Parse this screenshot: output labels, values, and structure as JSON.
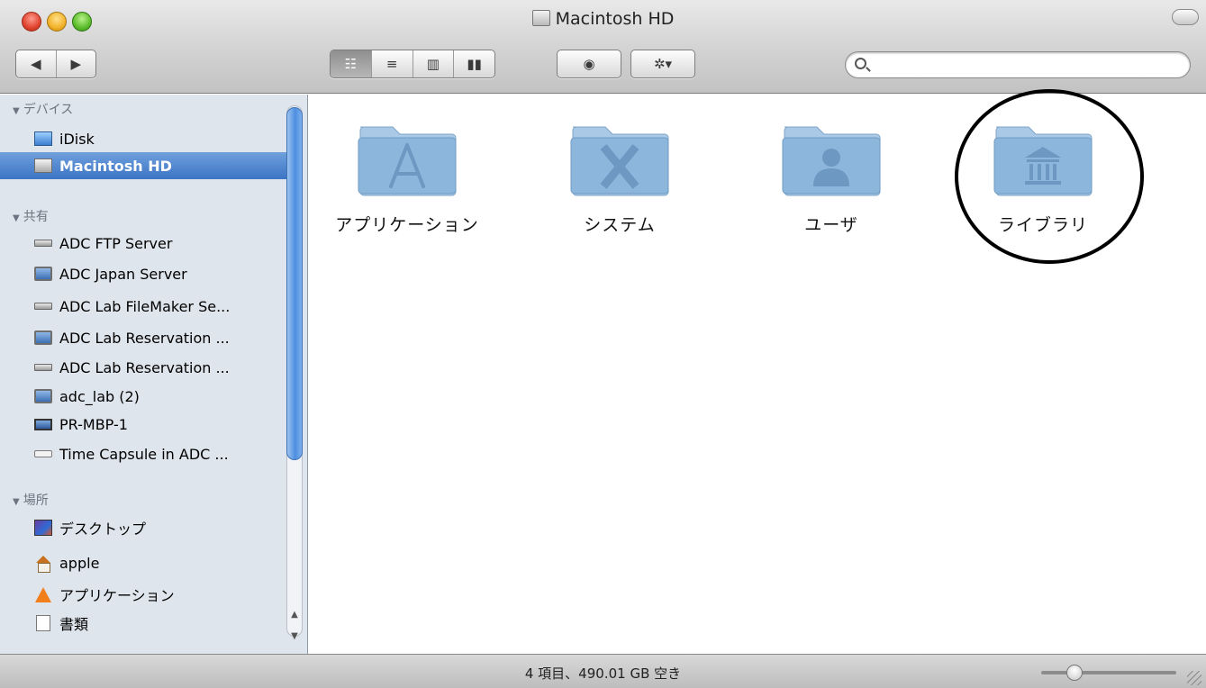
{
  "window": {
    "title": "Macintosh HD"
  },
  "toolbar": {
    "back_icon": "◀",
    "forward_icon": "▶",
    "view_icon_label": "☷",
    "view_list_label": "≡",
    "view_column_label": "▥",
    "view_coverflow_label": "▮▮",
    "quicklook_label": "◉",
    "action_label": "✲▾",
    "search_placeholder": "",
    "search_value": ""
  },
  "sidebar": {
    "devices_header": "デバイス",
    "devices": [
      {
        "label": "iDisk",
        "icon": "idisk-icon"
      },
      {
        "label": "Macintosh HD",
        "icon": "hard-disk-icon",
        "selected": true
      }
    ],
    "shared_header": "共有",
    "shared": [
      {
        "label": "ADC FTP Server",
        "icon": "server-icon"
      },
      {
        "label": "ADC Japan Server",
        "icon": "monitor-icon"
      },
      {
        "label": "ADC Lab FileMaker Se...",
        "icon": "server-icon"
      },
      {
        "label": "ADC Lab Reservation ...",
        "icon": "monitor-icon"
      },
      {
        "label": "ADC Lab Reservation ...",
        "icon": "server-icon"
      },
      {
        "label": "adc_lab (2)",
        "icon": "monitor-icon"
      },
      {
        "label": "PR-MBP-1",
        "icon": "laptop-icon"
      },
      {
        "label": "Time Capsule in ADC ...",
        "icon": "time-capsule-icon"
      }
    ],
    "places_header": "場所",
    "places": [
      {
        "label": "デスクトップ",
        "icon": "desktop-icon"
      },
      {
        "label": "apple",
        "icon": "home-icon"
      },
      {
        "label": "アプリケーション",
        "icon": "applications-icon"
      },
      {
        "label": "書類",
        "icon": "documents-icon"
      }
    ]
  },
  "content": {
    "items": [
      {
        "label": "アプリケーション",
        "glyph": "A",
        "icon": "applications-folder-icon"
      },
      {
        "label": "システム",
        "glyph": "X",
        "icon": "system-folder-icon"
      },
      {
        "label": "ユーザ",
        "glyph": "user",
        "icon": "users-folder-icon"
      },
      {
        "label": "ライブラリ",
        "glyph": "library",
        "icon": "library-folder-icon"
      }
    ]
  },
  "status": {
    "text": "4 項目、490.01 GB 空き"
  },
  "colors": {
    "selection": "#3c74c5",
    "sidebar_bg": "#dfe5ec",
    "folder": "#8eb6d9",
    "annotation_circle": "#000000"
  }
}
